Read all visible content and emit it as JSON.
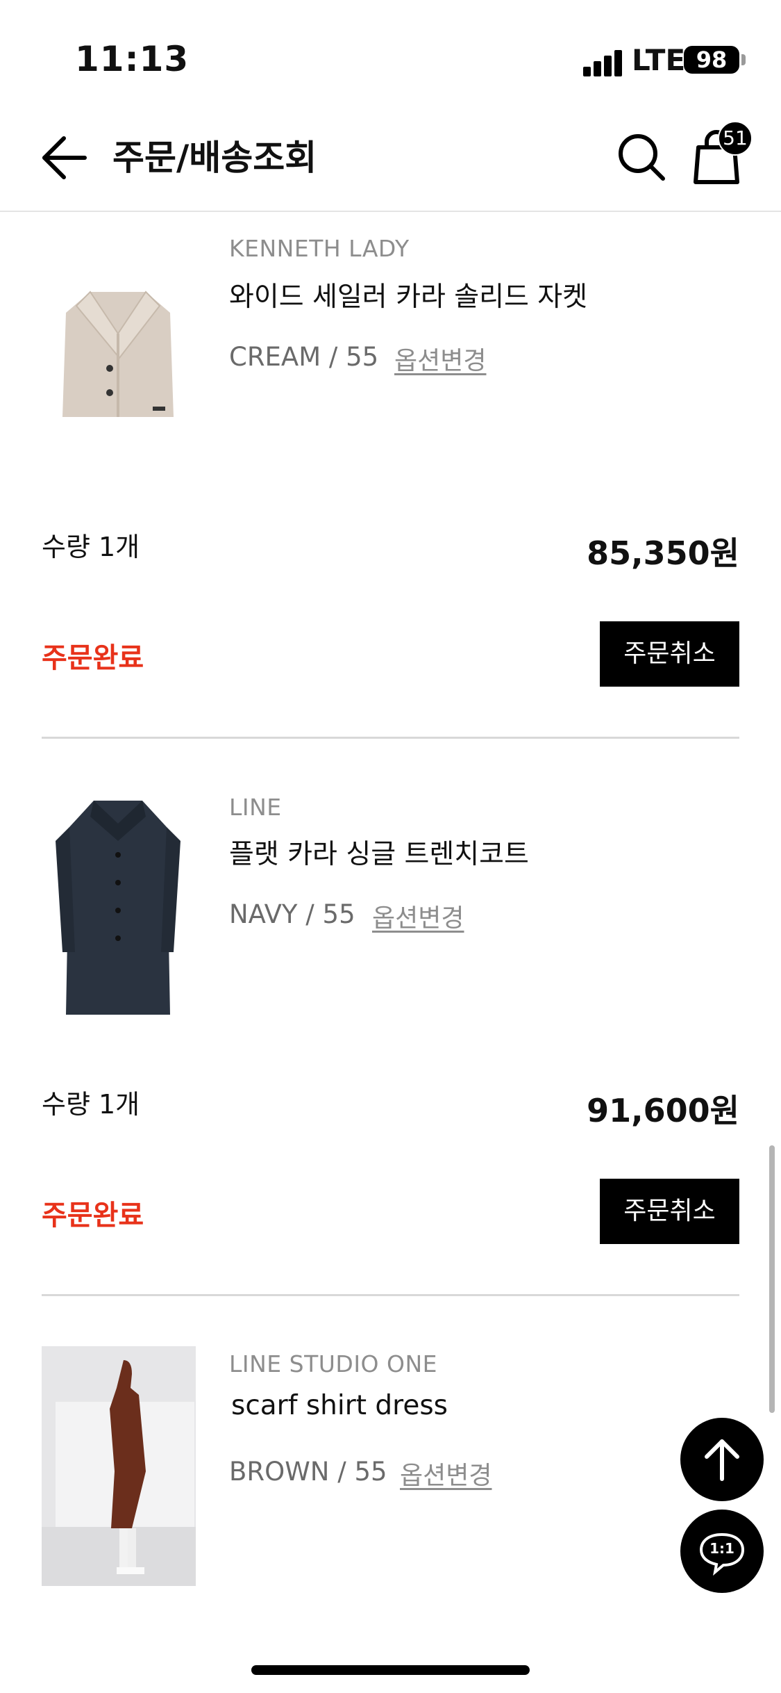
{
  "status_bar": {
    "time": "11:13",
    "network": "LTE",
    "battery": "98"
  },
  "header": {
    "title": "주문/배송조회",
    "cart_count": "51"
  },
  "orders": [
    {
      "brand": "KENNETH LADY",
      "name": "와이드 세일러 카라 솔리드 자켓",
      "option": "CREAM / 55",
      "option_change": "옵션변경",
      "quantity": "수량 1개",
      "price": "85,350원",
      "status": "주문완료",
      "cancel_label": "주문취소"
    },
    {
      "brand": "LINE",
      "name": "플랫 카라 싱글 트렌치코트",
      "option": "NAVY / 55",
      "option_change": "옵션변경",
      "quantity": "수량 1개",
      "price": "91,600원",
      "status": "주문완료",
      "cancel_label": "주문취소"
    },
    {
      "brand": "LINE STUDIO ONE",
      "name": "scarf shirt dress",
      "option": "BROWN / 55",
      "option_change": "옵션변경"
    }
  ],
  "colors": {
    "status": "#e8321a",
    "button": "#000000",
    "accent_brown": "#6b2e1c",
    "navy": "#2a3340",
    "cream": "#d9cec3"
  },
  "icons": [
    "back-arrow-icon",
    "search-icon",
    "shopping-bag-icon",
    "arrow-up-icon",
    "chat-icon"
  ],
  "chat_label": "1:1"
}
